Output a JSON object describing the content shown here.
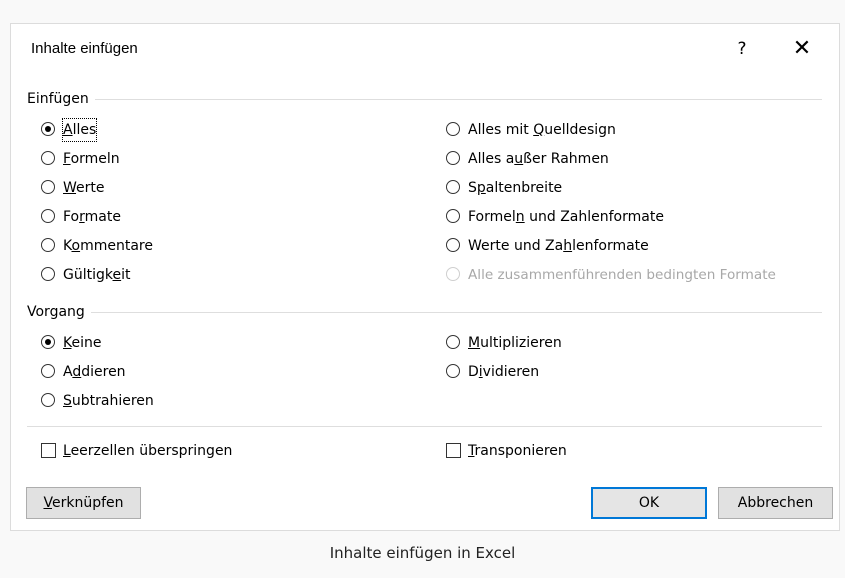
{
  "dialog": {
    "title": "Inhalte einfügen",
    "help_label": "?",
    "close_label": "✕"
  },
  "paste_group": {
    "label": "Einfügen",
    "left_options": [
      {
        "pre": "",
        "key": "A",
        "post": "lles",
        "checked": true
      },
      {
        "pre": "",
        "key": "F",
        "post": "ormeln",
        "checked": false
      },
      {
        "pre": "",
        "key": "W",
        "post": "erte",
        "checked": false
      },
      {
        "pre": "Fo",
        "key": "r",
        "post": "mate",
        "checked": false
      },
      {
        "pre": "K",
        "key": "o",
        "post": "mmentare",
        "checked": false
      },
      {
        "pre": "Gültigk",
        "key": "e",
        "post": "it",
        "checked": false
      }
    ],
    "right_options": [
      {
        "pre": "Alles mit ",
        "key": "Q",
        "post": "uelldesign",
        "checked": false,
        "disabled": false
      },
      {
        "pre": "Alles a",
        "key": "u",
        "post": "ßer Rahmen",
        "checked": false,
        "disabled": false
      },
      {
        "pre": "S",
        "key": "p",
        "post": "altenbreite",
        "checked": false,
        "disabled": false
      },
      {
        "pre": "Formel",
        "key": "n",
        "post": " und Zahlenformate",
        "checked": false,
        "disabled": false
      },
      {
        "pre": "Werte und Za",
        "key": "h",
        "post": "lenformate",
        "checked": false,
        "disabled": false
      },
      {
        "pre": "Alle zusammenführenden bedingten Formate",
        "key": "",
        "post": "",
        "checked": false,
        "disabled": true
      }
    ]
  },
  "operation_group": {
    "label": "Vorgang",
    "left_options": [
      {
        "pre": "",
        "key": "K",
        "post": "eine",
        "checked": true
      },
      {
        "pre": "A",
        "key": "d",
        "post": "dieren",
        "checked": false
      },
      {
        "pre": "",
        "key": "S",
        "post": "ubtrahieren",
        "checked": false
      }
    ],
    "right_options": [
      {
        "pre": "",
        "key": "M",
        "post": "ultiplizieren",
        "checked": false
      },
      {
        "pre": "D",
        "key": "i",
        "post": "vidieren",
        "checked": false
      }
    ]
  },
  "checkboxes": {
    "skip_blanks": {
      "pre": "",
      "key": "L",
      "post": "eerzellen überspringen",
      "checked": false
    },
    "transpose": {
      "pre": "",
      "key": "T",
      "post": "ransponieren",
      "checked": false
    }
  },
  "buttons": {
    "link": {
      "pre": "",
      "key": "V",
      "post": "erknüpfen"
    },
    "ok": "OK",
    "cancel": "Abbrechen"
  },
  "caption": "Inhalte einfügen in Excel",
  "colors": {
    "default_button_border": "#0078d7",
    "disabled_text": "#a8a8a8"
  }
}
